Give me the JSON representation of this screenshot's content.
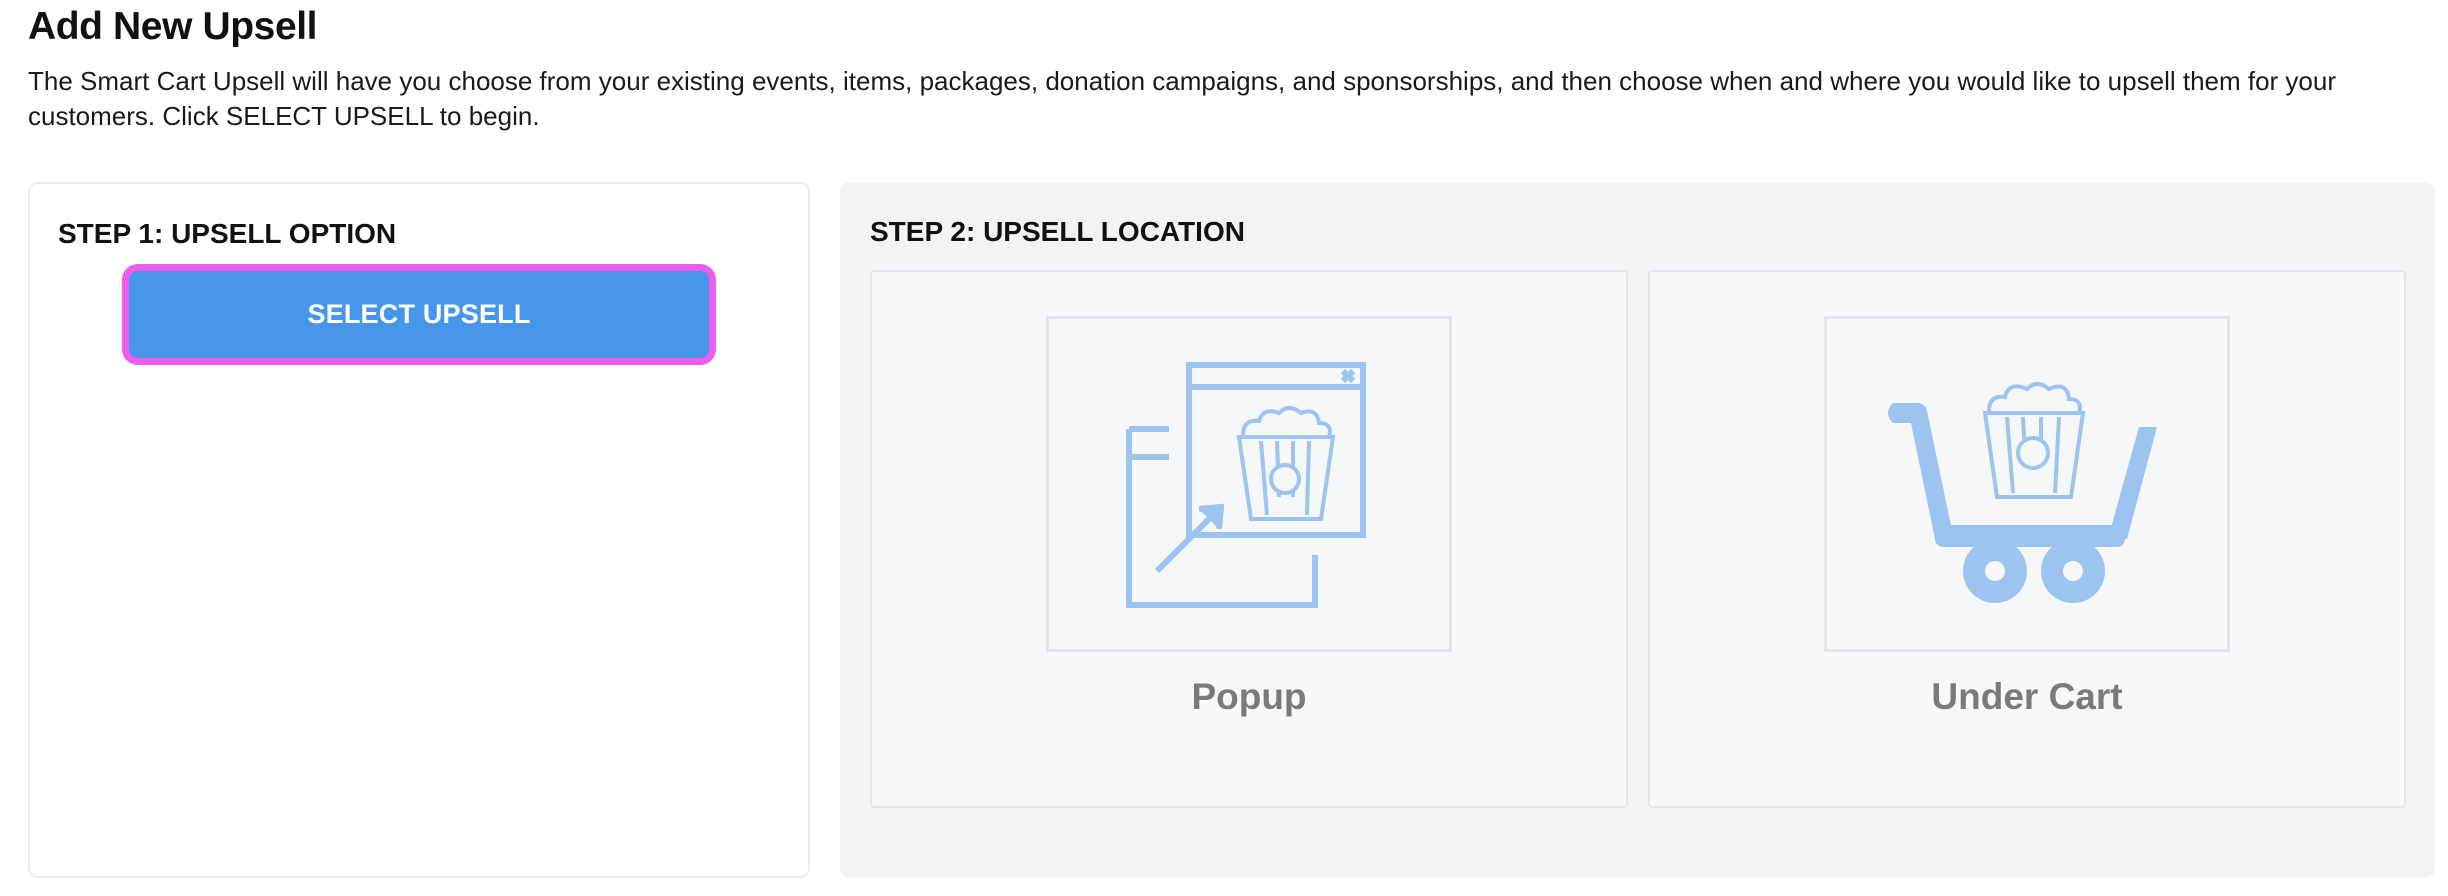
{
  "header": {
    "title": "Add New Upsell",
    "description": "The Smart Cart Upsell will have you choose from your existing events, items, packages, donation campaigns, and sponsorships, and then choose when and where you would like to upsell them for your customers. Click SELECT UPSELL to begin."
  },
  "step1": {
    "heading": "STEP 1: UPSELL OPTION",
    "button_label": "SELECT UPSELL"
  },
  "step2": {
    "heading": "STEP 2: UPSELL LOCATION",
    "options": [
      {
        "label": "Popup",
        "icon": "popup-window-icon"
      },
      {
        "label": "Under Cart",
        "icon": "shopping-cart-icon"
      }
    ]
  },
  "colors": {
    "button_background": "#4796ea",
    "button_highlight_border": "#ec5cf0",
    "icon_color": "#9dc3ef",
    "option_label": "#7a7a7a",
    "step2_background": "#f2f3f5"
  }
}
